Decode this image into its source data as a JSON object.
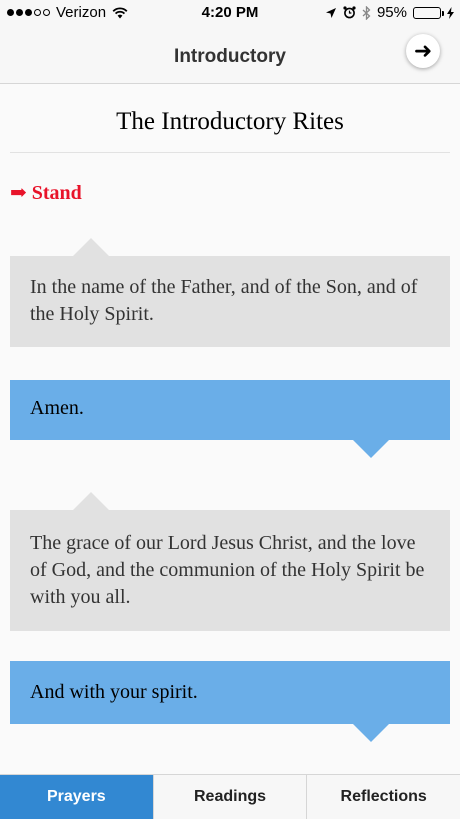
{
  "status_bar": {
    "carrier": "Verizon",
    "time": "4:20 PM",
    "battery": "95%",
    "battery_level": 0.95,
    "signal_bars_filled": 3,
    "signal_bars_total": 5,
    "icons": [
      "signal-icon",
      "wifi-icon",
      "location-arrow-icon",
      "alarm-icon",
      "bluetooth-icon",
      "battery-icon",
      "charging-bolt-icon"
    ]
  },
  "navbar": {
    "title": "Introductory",
    "next_icon": "arrow-right-icon",
    "next_glyph": "➜"
  },
  "content": {
    "section_title": "The Introductory Rites",
    "posture_icon": "hand-pointer-icon",
    "posture_glyph": "➡",
    "posture": "Stand",
    "exchanges": [
      {
        "role": "priest",
        "text": "In the name of the Father, and of the Son, and of the Holy Spirit."
      },
      {
        "role": "people",
        "text": "Amen."
      },
      {
        "role": "priest",
        "text": "The grace of our Lord Jesus Christ, and the love of God, and the communion of the Holy Spirit be with you all."
      },
      {
        "role": "people",
        "text": "And with your spirit."
      }
    ]
  },
  "tabs": [
    {
      "label": "Prayers",
      "active": true
    },
    {
      "label": "Readings",
      "active": false
    },
    {
      "label": "Reflections",
      "active": false
    }
  ],
  "colors": {
    "accent": "#3288d2",
    "people_bubble": "#6aaee8",
    "priest_bubble": "#e1e1e1",
    "posture_red": "#e8132a",
    "battery_green": "#4cd964"
  }
}
